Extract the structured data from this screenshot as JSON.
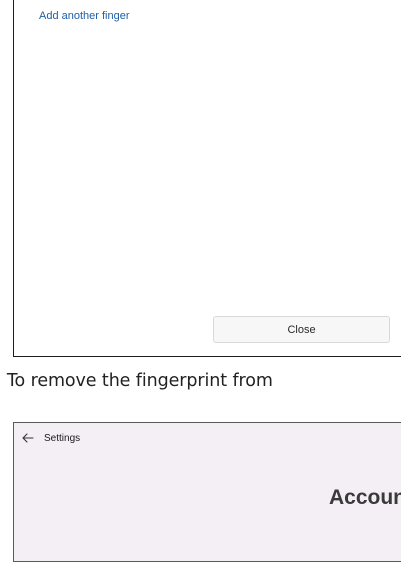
{
  "dialog": {
    "add_finger_link": "Add another finger",
    "close_button": "Close"
  },
  "article": {
    "text": ". To remove the fingerprint from"
  },
  "settings": {
    "back_icon": "back-arrow-icon",
    "app_title": "Settings",
    "page_heading": "Accoun"
  }
}
